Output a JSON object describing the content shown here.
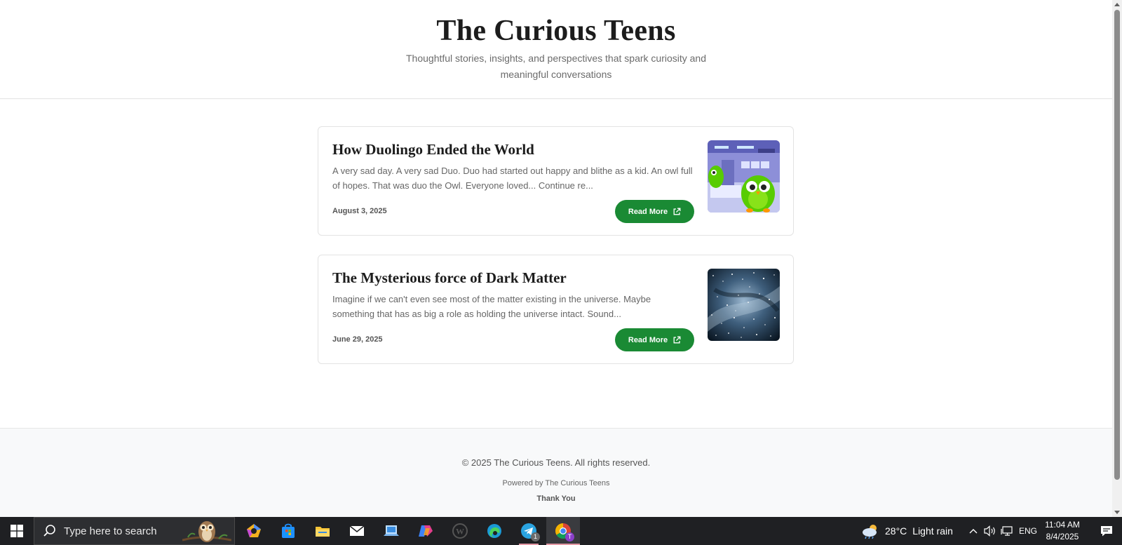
{
  "site": {
    "title": "The Curious Teens",
    "subtitle": "Thoughtful stories, insights, and perspectives that spark curiosity and meaningful conversations"
  },
  "posts": [
    {
      "title": "How Duolingo Ended the World",
      "excerpt": "A very sad day. A very sad Duo. Duo had started out happy and blithe as a kid. An owl full of hopes. That was duo the Owl. Everyone loved... Continue re...",
      "date": "August 3, 2025",
      "button_label": "Read More"
    },
    {
      "title": "The Mysterious force of Dark Matter",
      "excerpt": "Imagine if we can't even see most of the matter existing in the universe. Maybe something that has as big a role as holding the universe intact. Sound...",
      "date": "June 29, 2025",
      "button_label": "Read More"
    }
  ],
  "footer": {
    "copyright": "© 2025 The Curious Teens. All rights reserved.",
    "powered": "Powered by The Curious Teens",
    "thanks": "Thank You"
  },
  "taskbar": {
    "search_placeholder": "Type here to search",
    "weather_temp": "28°C",
    "weather_desc": "Light rain",
    "language": "ENG",
    "time": "11:04 AM",
    "date": "8/4/2025",
    "telegram_badge": "1",
    "chrome_badge": "T"
  },
  "colors": {
    "accent_green": "#1a8a34",
    "taskbar_bg": "#1f2023"
  }
}
